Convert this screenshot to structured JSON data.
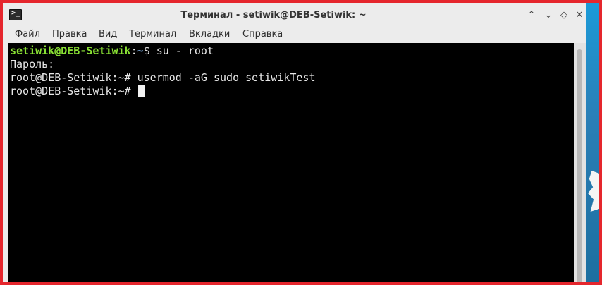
{
  "window": {
    "title": "Терминал - setiwik@DEB-Setiwik: ~",
    "icon": "terminal-icon",
    "controls": {
      "minimize": "⌃",
      "restore": "⌄",
      "maximize": "◇",
      "close": "✕"
    }
  },
  "menubar": {
    "items": [
      "Файл",
      "Правка",
      "Вид",
      "Терминал",
      "Вкладки",
      "Справка"
    ]
  },
  "terminal": {
    "lines": [
      {
        "user_host": "setiwik@DEB-Setiwik",
        "sep": ":",
        "path": "~",
        "prompt_char": "$",
        "command": " su - root"
      },
      {
        "text": "Пароль:"
      },
      {
        "prompt": "root@DEB-Setiwik:~#",
        "command": " usermod -aG sudo setiwikTest"
      },
      {
        "prompt": "root@DEB-Setiwik:~#",
        "command": " "
      }
    ]
  },
  "colors": {
    "user_prompt": "#8ae234",
    "path": "#729fcf",
    "terminal_bg": "#000000",
    "frame_border": "#e5262d"
  }
}
